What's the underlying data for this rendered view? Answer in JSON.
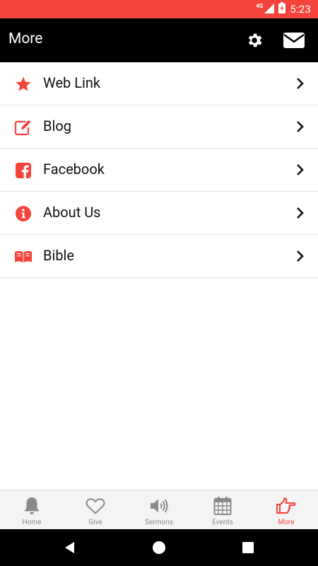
{
  "status_bar": {
    "network": "4G",
    "time": "5:23"
  },
  "app_bar": {
    "title": "More"
  },
  "menu_items": [
    {
      "label": "Web Link",
      "icon": "star-icon"
    },
    {
      "label": "Blog",
      "icon": "edit-icon"
    },
    {
      "label": "Facebook",
      "icon": "facebook-icon"
    },
    {
      "label": "About Us",
      "icon": "info-icon"
    },
    {
      "label": "Bible",
      "icon": "book-icon"
    }
  ],
  "tabs": [
    {
      "label": "Home",
      "icon": "bell-icon",
      "active": false
    },
    {
      "label": "Give",
      "icon": "heart-icon",
      "active": false
    },
    {
      "label": "Sermons",
      "icon": "speaker-icon",
      "active": false
    },
    {
      "label": "Events",
      "icon": "calendar-icon",
      "active": false
    },
    {
      "label": "More",
      "icon": "pointing-hand-icon",
      "active": true
    }
  ],
  "colors": {
    "accent": "#f4433b",
    "app_bar": "#000000",
    "tab_inactive": "#8a8a8a"
  }
}
